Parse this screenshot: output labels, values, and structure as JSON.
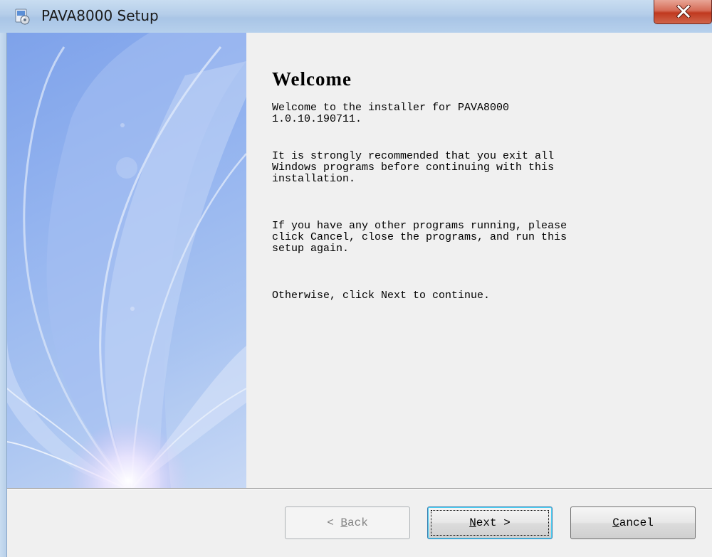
{
  "window": {
    "title": "PAVA8000 Setup"
  },
  "colors": {
    "banner_blue": "#8eaeee",
    "close_red": "#c8432a",
    "focus_blue": "#3c7fb1"
  },
  "icons": {
    "app": "installer-icon",
    "close": "close-icon"
  },
  "page": {
    "heading": "Welcome",
    "paragraphs": [
      "Welcome to the installer for PAVA8000\n1.0.10.190711.",
      "It is strongly recommended that you exit all\nWindows programs before continuing with this\ninstallation.",
      "If you have any other programs running, please\nclick Cancel, close the programs, and run this\nsetup again.",
      "Otherwise, click Next to continue."
    ]
  },
  "buttons": {
    "back": {
      "prefix": "< ",
      "mnemonic": "B",
      "rest": "ack",
      "enabled": false
    },
    "next": {
      "mnemonic": "N",
      "rest": "ext >",
      "enabled": true,
      "default": true
    },
    "cancel": {
      "mnemonic": "C",
      "rest": "ancel",
      "enabled": true
    }
  }
}
